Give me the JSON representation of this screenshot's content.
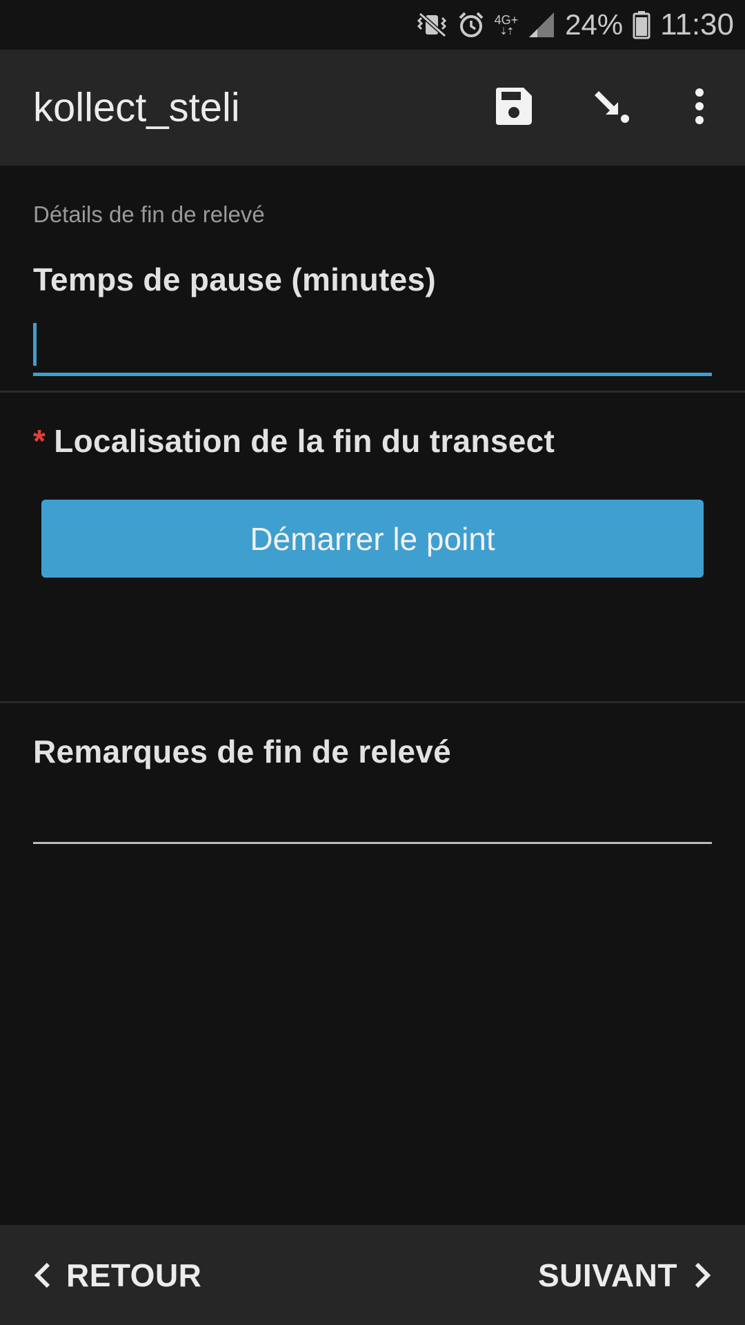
{
  "status_bar": {
    "network_type": "4G+",
    "battery_percent": "24%",
    "time": "11:30",
    "icons": [
      "vibrate-icon",
      "alarm-icon",
      "network-4g-icon",
      "signal-icon",
      "battery-icon"
    ]
  },
  "app_bar": {
    "title": "kollect_steli",
    "actions": [
      "save-icon",
      "goto-icon",
      "more-vert-icon"
    ]
  },
  "form": {
    "group_label": "Détails de fin de relevé",
    "q1": {
      "label": "Temps de pause (minutes)",
      "value": "",
      "placeholder": ""
    },
    "q2": {
      "required_mark": "*",
      "label": "Localisation de la fin du transect",
      "button_label": "Démarrer le point"
    },
    "q3": {
      "label": "Remarques de fin de relevé",
      "value": "",
      "placeholder": ""
    }
  },
  "bottom_nav": {
    "back_label": "RETOUR",
    "next_label": "SUIVANT"
  },
  "colors": {
    "background": "#121212",
    "bar": "#262626",
    "accent": "#3f9fcf",
    "required": "#e0403a"
  }
}
